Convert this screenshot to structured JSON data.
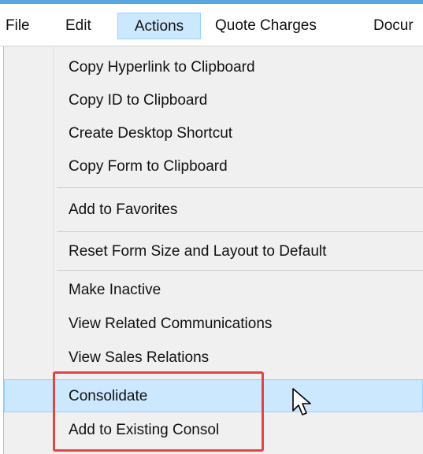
{
  "menubar": {
    "items": [
      {
        "label": "File",
        "active": false
      },
      {
        "label": "Edit",
        "active": false
      },
      {
        "label": "Actions",
        "active": true
      },
      {
        "label": "Quote Charges",
        "active": false
      },
      {
        "label": "Docur",
        "active": false
      }
    ]
  },
  "actions_menu": {
    "items": [
      {
        "label": "Copy Hyperlink to Clipboard"
      },
      {
        "label": "Copy ID to Clipboard"
      },
      {
        "label": "Create Desktop Shortcut"
      },
      {
        "label": "Copy Form to Clipboard"
      },
      {
        "label": "Add to Favorites"
      },
      {
        "label": "Reset Form Size and Layout to Default"
      },
      {
        "label": "Make Inactive"
      },
      {
        "label": "View Related Communications"
      },
      {
        "label": "View Sales Relations"
      },
      {
        "label": "Consolidate",
        "highlighted": true
      },
      {
        "label": "Add to Existing Consol"
      }
    ]
  },
  "colors": {
    "highlight_fill": "#cce8ff",
    "highlight_border": "#99d1ff",
    "callout_border": "#e04545",
    "menu_background": "#f0f0f0"
  },
  "cursor": {
    "icon": "mouse-pointer-icon"
  }
}
